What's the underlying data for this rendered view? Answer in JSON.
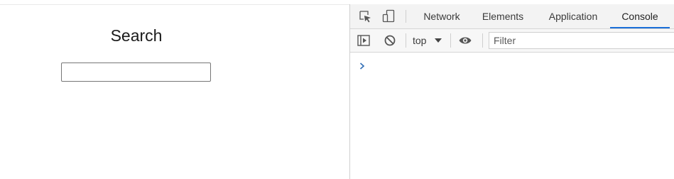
{
  "page": {
    "title": "Search",
    "search_value": ""
  },
  "devtools": {
    "tabs": [
      {
        "label": "Network"
      },
      {
        "label": "Elements"
      },
      {
        "label": "Application"
      },
      {
        "label": "Console",
        "active": true
      }
    ],
    "toolbar": {
      "context_value": "top",
      "filter_placeholder": "Filter"
    },
    "icons": {
      "inspect": "inspect-element-icon",
      "device": "device-toolbar-icon",
      "sidebar": "show-sidebar-icon",
      "clear": "clear-console-icon",
      "eye": "live-expression-icon",
      "dropdown": "chevron-down-icon",
      "prompt": "console-prompt-chevron-icon"
    },
    "colors": {
      "active_tab_underline": "#1a6fd8",
      "prompt_chevron": "#2f6db5"
    }
  }
}
